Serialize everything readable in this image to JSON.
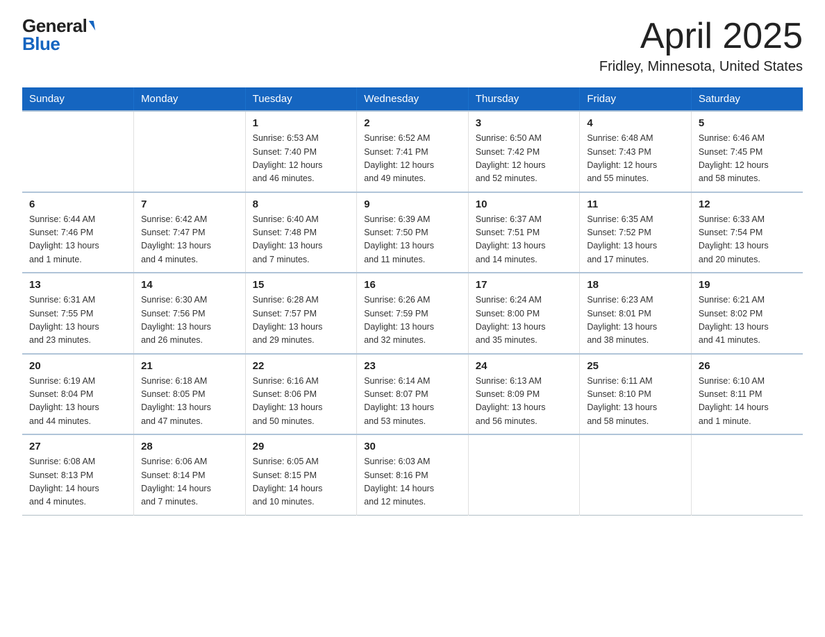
{
  "logo": {
    "general": "General",
    "blue": "Blue"
  },
  "title": "April 2025",
  "subtitle": "Fridley, Minnesota, United States",
  "weekdays": [
    "Sunday",
    "Monday",
    "Tuesday",
    "Wednesday",
    "Thursday",
    "Friday",
    "Saturday"
  ],
  "weeks": [
    [
      {
        "day": null,
        "info": null
      },
      {
        "day": null,
        "info": null
      },
      {
        "day": "1",
        "info": "Sunrise: 6:53 AM\nSunset: 7:40 PM\nDaylight: 12 hours\nand 46 minutes."
      },
      {
        "day": "2",
        "info": "Sunrise: 6:52 AM\nSunset: 7:41 PM\nDaylight: 12 hours\nand 49 minutes."
      },
      {
        "day": "3",
        "info": "Sunrise: 6:50 AM\nSunset: 7:42 PM\nDaylight: 12 hours\nand 52 minutes."
      },
      {
        "day": "4",
        "info": "Sunrise: 6:48 AM\nSunset: 7:43 PM\nDaylight: 12 hours\nand 55 minutes."
      },
      {
        "day": "5",
        "info": "Sunrise: 6:46 AM\nSunset: 7:45 PM\nDaylight: 12 hours\nand 58 minutes."
      }
    ],
    [
      {
        "day": "6",
        "info": "Sunrise: 6:44 AM\nSunset: 7:46 PM\nDaylight: 13 hours\nand 1 minute."
      },
      {
        "day": "7",
        "info": "Sunrise: 6:42 AM\nSunset: 7:47 PM\nDaylight: 13 hours\nand 4 minutes."
      },
      {
        "day": "8",
        "info": "Sunrise: 6:40 AM\nSunset: 7:48 PM\nDaylight: 13 hours\nand 7 minutes."
      },
      {
        "day": "9",
        "info": "Sunrise: 6:39 AM\nSunset: 7:50 PM\nDaylight: 13 hours\nand 11 minutes."
      },
      {
        "day": "10",
        "info": "Sunrise: 6:37 AM\nSunset: 7:51 PM\nDaylight: 13 hours\nand 14 minutes."
      },
      {
        "day": "11",
        "info": "Sunrise: 6:35 AM\nSunset: 7:52 PM\nDaylight: 13 hours\nand 17 minutes."
      },
      {
        "day": "12",
        "info": "Sunrise: 6:33 AM\nSunset: 7:54 PM\nDaylight: 13 hours\nand 20 minutes."
      }
    ],
    [
      {
        "day": "13",
        "info": "Sunrise: 6:31 AM\nSunset: 7:55 PM\nDaylight: 13 hours\nand 23 minutes."
      },
      {
        "day": "14",
        "info": "Sunrise: 6:30 AM\nSunset: 7:56 PM\nDaylight: 13 hours\nand 26 minutes."
      },
      {
        "day": "15",
        "info": "Sunrise: 6:28 AM\nSunset: 7:57 PM\nDaylight: 13 hours\nand 29 minutes."
      },
      {
        "day": "16",
        "info": "Sunrise: 6:26 AM\nSunset: 7:59 PM\nDaylight: 13 hours\nand 32 minutes."
      },
      {
        "day": "17",
        "info": "Sunrise: 6:24 AM\nSunset: 8:00 PM\nDaylight: 13 hours\nand 35 minutes."
      },
      {
        "day": "18",
        "info": "Sunrise: 6:23 AM\nSunset: 8:01 PM\nDaylight: 13 hours\nand 38 minutes."
      },
      {
        "day": "19",
        "info": "Sunrise: 6:21 AM\nSunset: 8:02 PM\nDaylight: 13 hours\nand 41 minutes."
      }
    ],
    [
      {
        "day": "20",
        "info": "Sunrise: 6:19 AM\nSunset: 8:04 PM\nDaylight: 13 hours\nand 44 minutes."
      },
      {
        "day": "21",
        "info": "Sunrise: 6:18 AM\nSunset: 8:05 PM\nDaylight: 13 hours\nand 47 minutes."
      },
      {
        "day": "22",
        "info": "Sunrise: 6:16 AM\nSunset: 8:06 PM\nDaylight: 13 hours\nand 50 minutes."
      },
      {
        "day": "23",
        "info": "Sunrise: 6:14 AM\nSunset: 8:07 PM\nDaylight: 13 hours\nand 53 minutes."
      },
      {
        "day": "24",
        "info": "Sunrise: 6:13 AM\nSunset: 8:09 PM\nDaylight: 13 hours\nand 56 minutes."
      },
      {
        "day": "25",
        "info": "Sunrise: 6:11 AM\nSunset: 8:10 PM\nDaylight: 13 hours\nand 58 minutes."
      },
      {
        "day": "26",
        "info": "Sunrise: 6:10 AM\nSunset: 8:11 PM\nDaylight: 14 hours\nand 1 minute."
      }
    ],
    [
      {
        "day": "27",
        "info": "Sunrise: 6:08 AM\nSunset: 8:13 PM\nDaylight: 14 hours\nand 4 minutes."
      },
      {
        "day": "28",
        "info": "Sunrise: 6:06 AM\nSunset: 8:14 PM\nDaylight: 14 hours\nand 7 minutes."
      },
      {
        "day": "29",
        "info": "Sunrise: 6:05 AM\nSunset: 8:15 PM\nDaylight: 14 hours\nand 10 minutes."
      },
      {
        "day": "30",
        "info": "Sunrise: 6:03 AM\nSunset: 8:16 PM\nDaylight: 14 hours\nand 12 minutes."
      },
      {
        "day": null,
        "info": null
      },
      {
        "day": null,
        "info": null
      },
      {
        "day": null,
        "info": null
      }
    ]
  ]
}
